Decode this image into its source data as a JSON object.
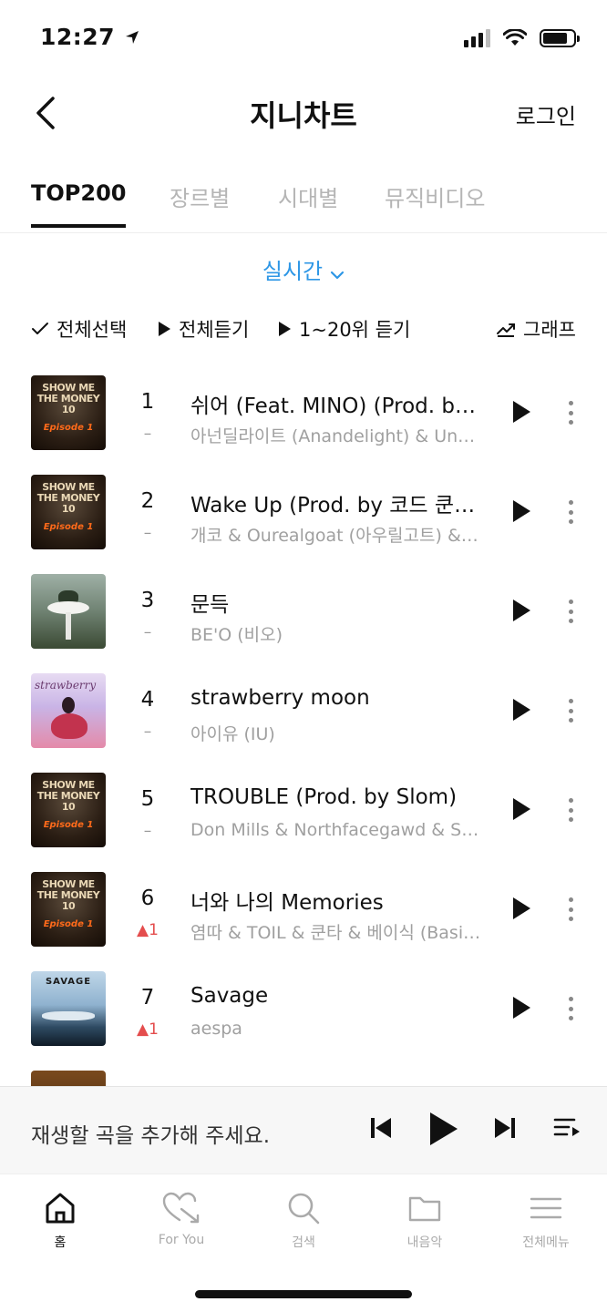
{
  "status_bar": {
    "time": "12:27",
    "location_icon": "location-arrow-icon"
  },
  "header": {
    "title": "지니차트",
    "login_label": "로그인"
  },
  "tabs": [
    {
      "label": "TOP200",
      "active": true
    },
    {
      "label": "장르별",
      "active": false
    },
    {
      "label": "시대별",
      "active": false
    },
    {
      "label": "뮤직비디오",
      "active": false
    }
  ],
  "filter": {
    "label": "실시간"
  },
  "actions": {
    "select_all": "전체선택",
    "play_all": "전체듣기",
    "play_top20": "1~20위 듣기",
    "graph": "그래프"
  },
  "colors": {
    "accent": "#2e97e6",
    "rank_up": "#e44d4d"
  },
  "chart": [
    {
      "rank": "1",
      "change": "–",
      "change_dir": "same",
      "title": "쉬어 (Feat. MINO) (Prod. by…",
      "artist": "아넌딜라이트 (Anandelight) & Un…",
      "cover": "smtm-cover"
    },
    {
      "rank": "2",
      "change": "–",
      "change_dir": "same",
      "title": "Wake Up (Prod. by 코드 쿤…",
      "artist": "개코 & Ourealgoat (아우릴고트) &…",
      "cover": "smtm-cover"
    },
    {
      "rank": "3",
      "change": "–",
      "change_dir": "same",
      "title": "문득",
      "artist": "BE'O (비오)",
      "cover": "beo-cover"
    },
    {
      "rank": "4",
      "change": "–",
      "change_dir": "same",
      "title": "strawberry moon",
      "artist": "아이유 (IU)",
      "cover": "iu-cover"
    },
    {
      "rank": "5",
      "change": "–",
      "change_dir": "same",
      "title": "TROUBLE (Prod. by Slom)",
      "artist": "Don Mills & Northfacegawd & S…",
      "cover": "smtm-cover"
    },
    {
      "rank": "6",
      "change": "▲1",
      "change_dir": "up",
      "title": "너와 나의 Memories",
      "artist": "염따 & TOIL & 쿤타 & 베이식 (Basi…",
      "cover": "smtm-cover"
    },
    {
      "rank": "7",
      "change": "▲1",
      "change_dir": "up",
      "title": "Savage",
      "artist": "aespa",
      "cover": "aespa-cover"
    }
  ],
  "covers": {
    "smtm_text": "SHOW ME THE MONEY 10",
    "smtm_episode": "Episode 1",
    "iu_script": "strawberry",
    "aespa_logo": "SAVAGE"
  },
  "mini_player": {
    "text": "재생할 곡을 추가해 주세요."
  },
  "bottom_nav": [
    {
      "label": "홈",
      "icon": "home-icon",
      "active": true
    },
    {
      "label": "For You",
      "icon": "heart-arrow-icon",
      "active": false
    },
    {
      "label": "검색",
      "icon": "search-icon",
      "active": false
    },
    {
      "label": "내음악",
      "icon": "folder-icon",
      "active": false
    },
    {
      "label": "전체메뉴",
      "icon": "menu-icon",
      "active": false
    }
  ]
}
